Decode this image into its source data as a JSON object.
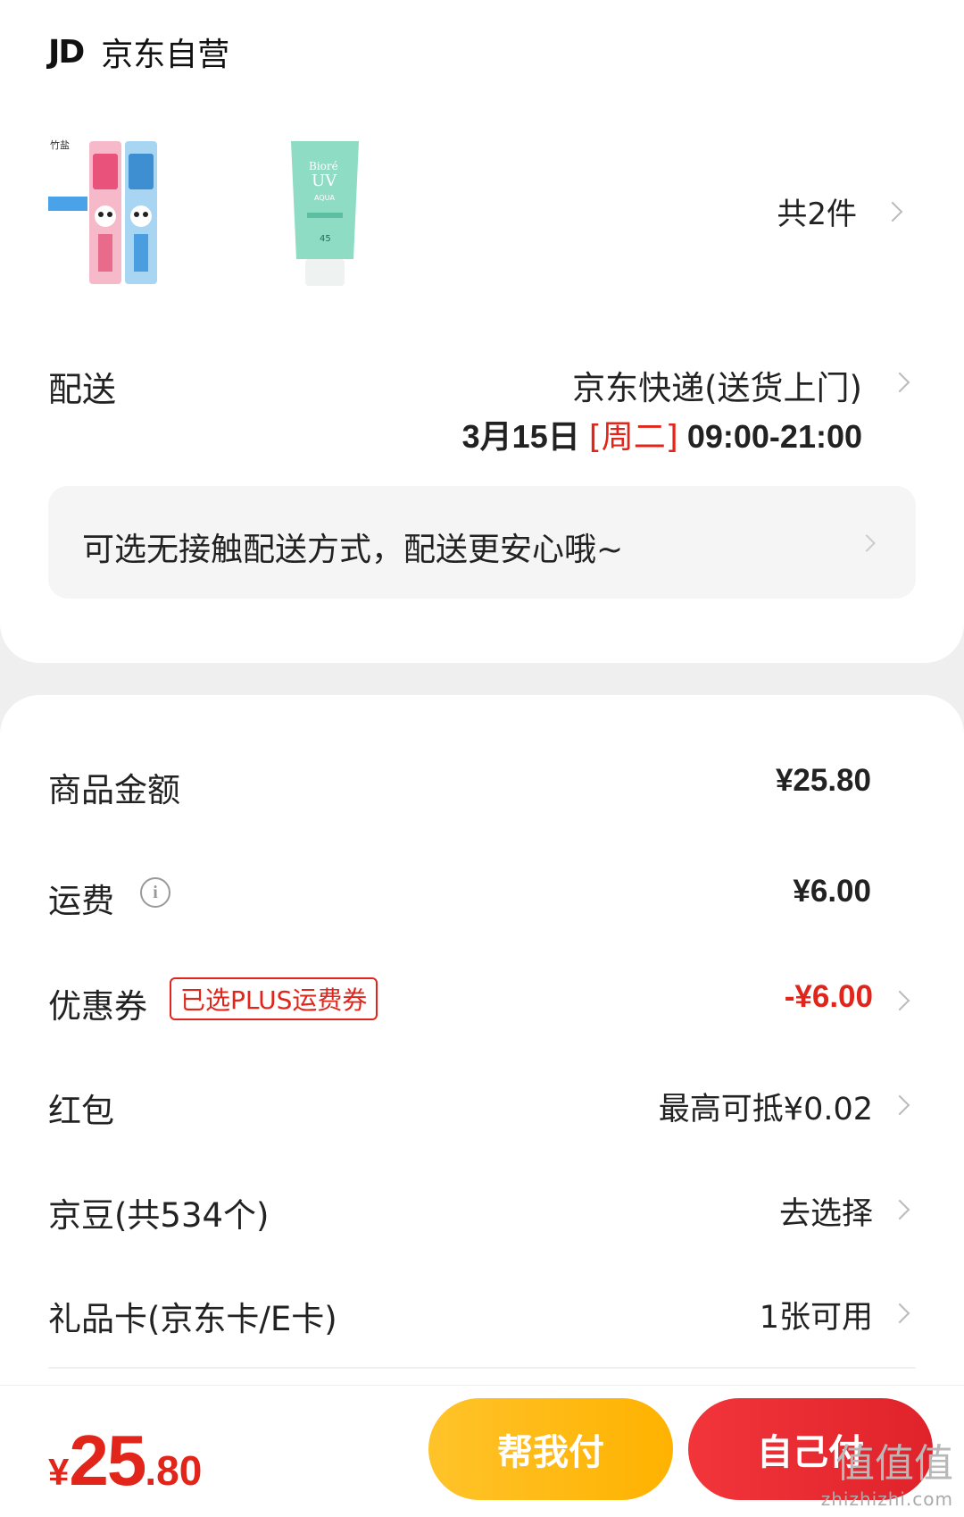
{
  "shop": {
    "logo": "JD",
    "name": "京东自营"
  },
  "products": {
    "items": [
      {
        "name": "toothbrush-pack",
        "brand_text": "竹盐"
      },
      {
        "name": "sunscreen-tube",
        "brand_text": "Bioré UV"
      }
    ],
    "count_label": "共2件"
  },
  "delivery": {
    "label": "配送",
    "method": "京东快递(送货上门)",
    "date": "3月15日",
    "weekday": "[周二]",
    "time": "09:00-21:00"
  },
  "notice": {
    "text": "可选无接触配送方式，配送更安心哦~"
  },
  "summary": {
    "goods_amount": {
      "label": "商品金额",
      "value": "¥25.80"
    },
    "shipping": {
      "label": "运费",
      "value": "¥6.00"
    },
    "coupon": {
      "label": "优惠券",
      "tag": "已选PLUS运费券",
      "value": "-¥6.00"
    },
    "red_packet": {
      "label": "红包",
      "value": "最高可抵¥0.02"
    },
    "jd_beans": {
      "label": "京豆(共534个)",
      "value": "去选择"
    },
    "gift_card": {
      "label": "礼品卡(京东卡/E卡)",
      "value": "1张可用"
    }
  },
  "footer": {
    "total_yen": "¥",
    "total_int": "25",
    "total_dec": ".80",
    "help_pay_label": "帮我付",
    "self_pay_label": "自己付"
  },
  "watermark": {
    "logo": "值值值",
    "text": "zhizhizhi.com"
  },
  "colors": {
    "accent_red": "#e1251b",
    "button_yellow": "#ffc32a",
    "button_red": "#f2353b"
  }
}
